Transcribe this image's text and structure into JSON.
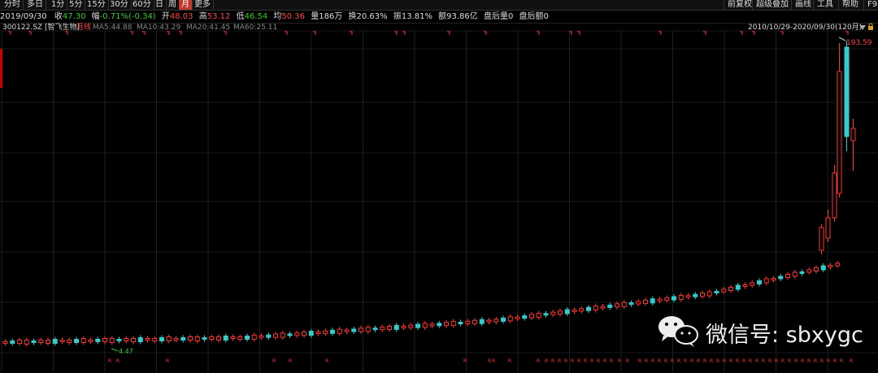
{
  "toolbar": {
    "items": [
      "分时",
      "多日",
      "1分",
      "5分",
      "15分",
      "30分",
      "60分",
      "日",
      "周",
      "月",
      "更多"
    ],
    "active_index": 9,
    "right_items": [
      "前复权",
      "超级叠加",
      "画线",
      "工具",
      "帮助",
      "F9"
    ]
  },
  "quote": {
    "date": "2019/09/30",
    "close_label": "收",
    "close_value": "47.30",
    "change_label": "幅",
    "change_value": "-0.71%(-0.34)",
    "open_label": "开",
    "open_value": "48.03",
    "high_label": "高",
    "high_value": "53.12",
    "low_label": "低",
    "low_value": "46.54",
    "avg_label": "均",
    "avg_value": "50.36",
    "volume_label": "量",
    "volume_value": "186万",
    "turnover_label": "换",
    "turnover_value": "20.63%",
    "amplitude_label": "振",
    "amplitude_value": "13.81%",
    "amount_label": "额",
    "amount_value": "93.86亿",
    "after_vol_label": "盘后量",
    "after_vol_value": "0",
    "after_amt_label": "盘后额",
    "after_amt_value": "0"
  },
  "indicator_bar": {
    "stock": "300122.SZ [智飞生物]",
    "period": "月线",
    "ma5": "MA5:44.88",
    "ma10": "MA10:43.29",
    "ma20": "MA20:41.45",
    "ma60": "MA60:25.11",
    "range": "2010/10/29-2020/09/30(120月)"
  },
  "colors": {
    "up": "#ff3333",
    "down": "#33cccc",
    "grid": "#333333",
    "text_red": "#ff4444",
    "text_green": "#33cc33"
  },
  "chart_data": {
    "type": "candlestick",
    "period": "monthly",
    "bars": 120,
    "annotations": {
      "high_label": "193.59",
      "low_label": "4.47"
    }
  },
  "watermark": {
    "text": "微信号: sbxygc",
    "icon": "wechat-icon"
  }
}
